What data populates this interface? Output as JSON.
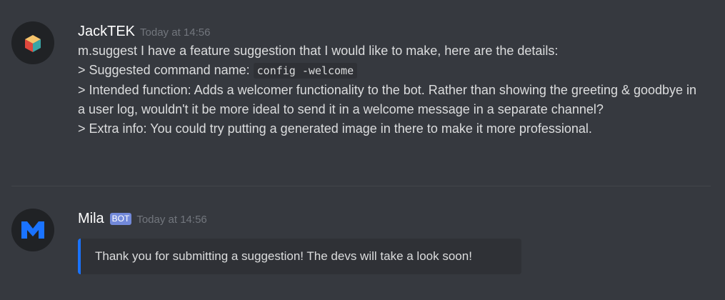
{
  "messages": [
    {
      "author": "JackTEK",
      "timestamp": "Today at 14:56",
      "avatar_icon": "colored-cube-icon",
      "lines": {
        "line1": "m.suggest I have a feature suggestion that I would like to make, here are the details:",
        "line2_prefix": "> Suggested command name: ",
        "line2_code": "config -welcome",
        "line3": "> Intended function: Adds a welcomer functionality to the bot. Rather than showing the greeting & goodbye in a user log, wouldn't it be more ideal to send it in a welcome message in a separate channel?",
        "line4": "> Extra info: You could try putting a generated image in there to make it more professional."
      }
    },
    {
      "author": "Mila",
      "bot_tag": "BOT",
      "timestamp": "Today at 14:56",
      "avatar_icon": "mila-m-logo-icon",
      "embed_text": "Thank you for submitting a suggestion! The devs will take a look soon!",
      "embed_color": "#1a73ff"
    }
  ],
  "colors": {
    "background": "#36393f",
    "username": "#ffffff",
    "timestamp": "#72767d",
    "bot_tag": "#7289da",
    "embed_background": "#2f3136"
  }
}
